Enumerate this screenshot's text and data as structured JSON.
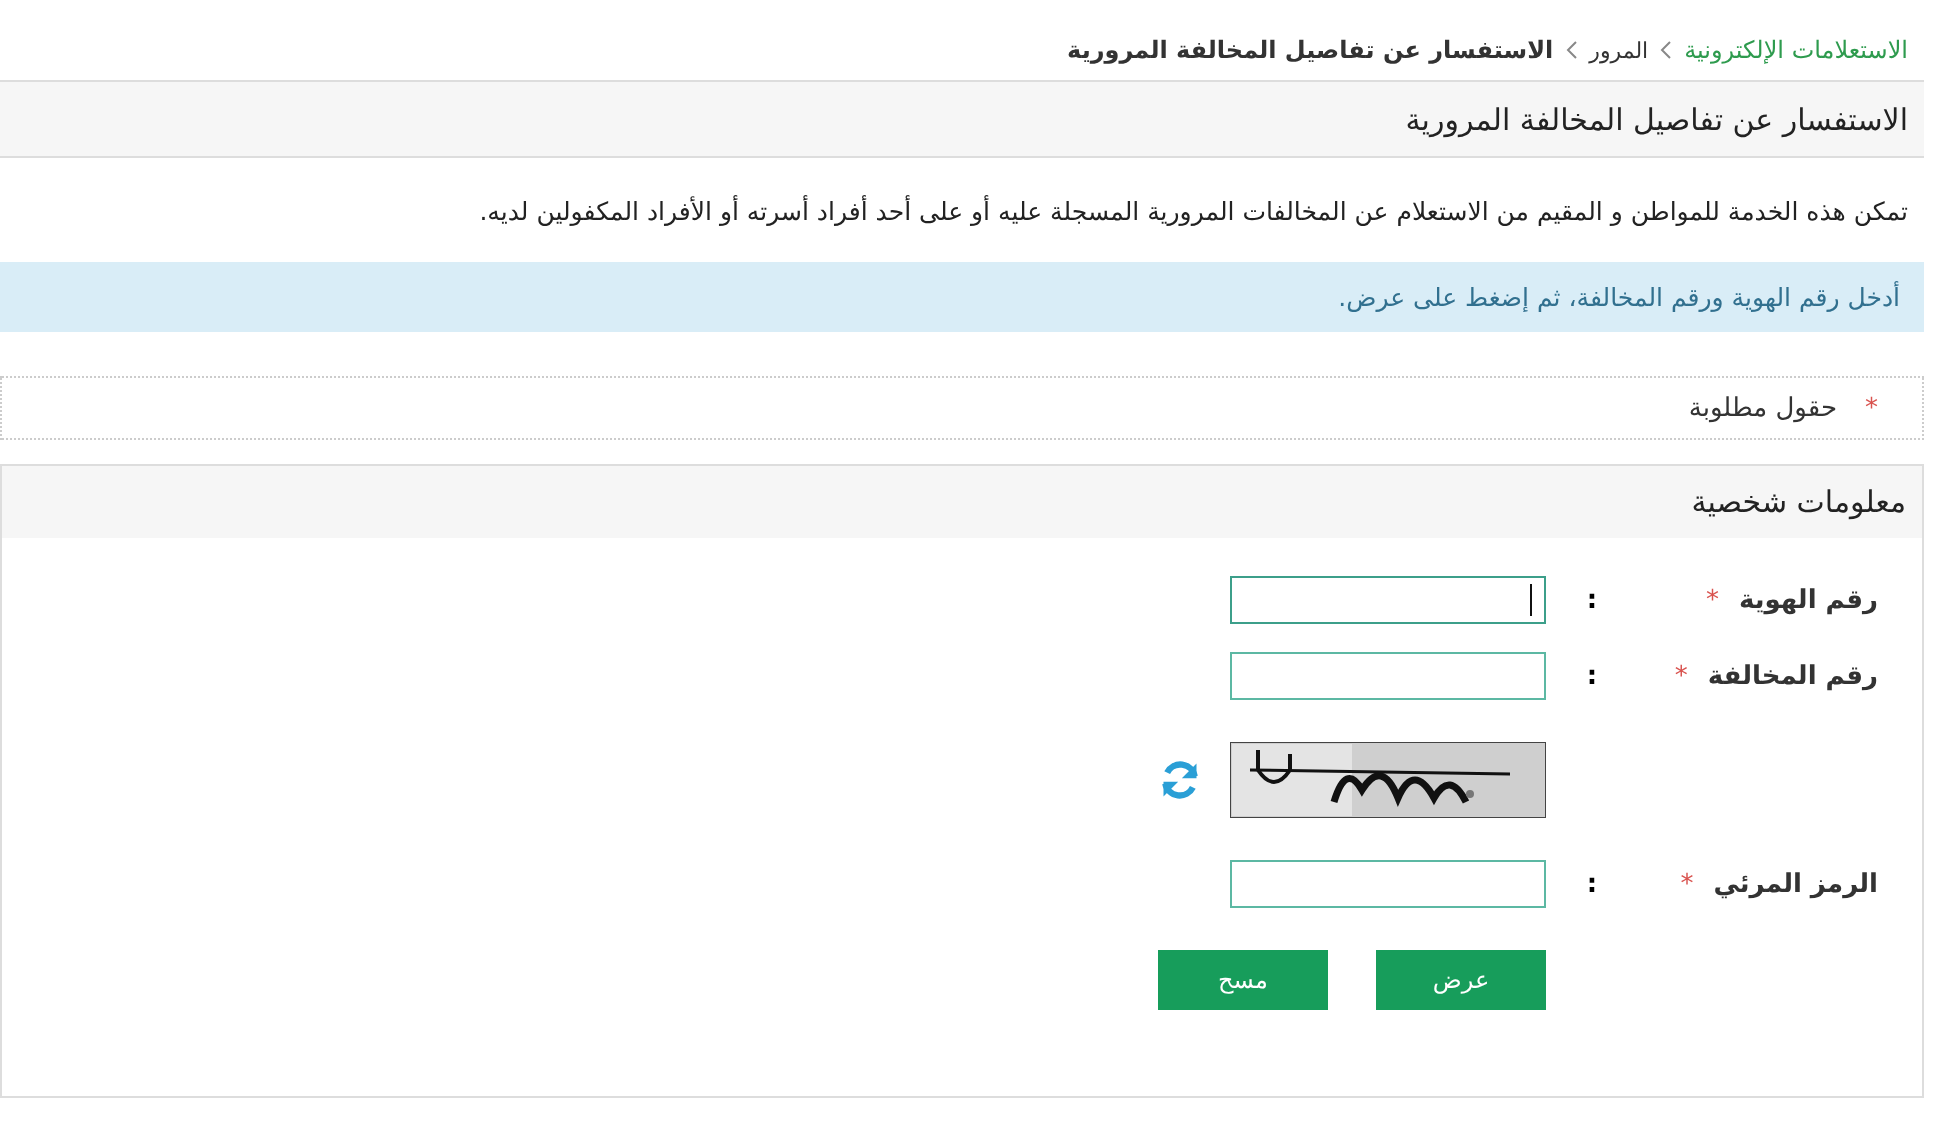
{
  "breadcrumb": [
    {
      "label": "الاستعلامات الإلكترونية",
      "kind": "link"
    },
    {
      "label": "المرور",
      "kind": "link-plain"
    },
    {
      "label": "الاستفسار عن تفاصيل المخالفة المرورية",
      "kind": "current"
    }
  ],
  "page_title": "الاستفسار عن تفاصيل المخالفة المرورية",
  "description": "تمكن هذه الخدمة للمواطن و المقيم من الاستعلام عن المخالفات المرورية المسجلة عليه أو على أحد أفراد أسرته أو الأفراد المكفولين لديه.",
  "info_message": "أدخل رقم الهوية ورقم المخالفة، ثم إضغط على عرض.",
  "required_note": {
    "mark": "*",
    "label": "حقول مطلوبة"
  },
  "section": {
    "title": "معلومات شخصية",
    "rows": [
      {
        "kind": "input",
        "label": "رقم الهوية",
        "mark": "*",
        "colon": ":",
        "focused": true
      },
      {
        "kind": "input",
        "label": "رقم المخالفة",
        "mark": "*",
        "colon": ":",
        "focused": false
      },
      {
        "kind": "captcha"
      },
      {
        "kind": "input",
        "label": "الرمز المرئي",
        "mark": "*",
        "colon": ":",
        "focused": false
      }
    ],
    "buttons": [
      "عرض",
      "مسح"
    ]
  }
}
